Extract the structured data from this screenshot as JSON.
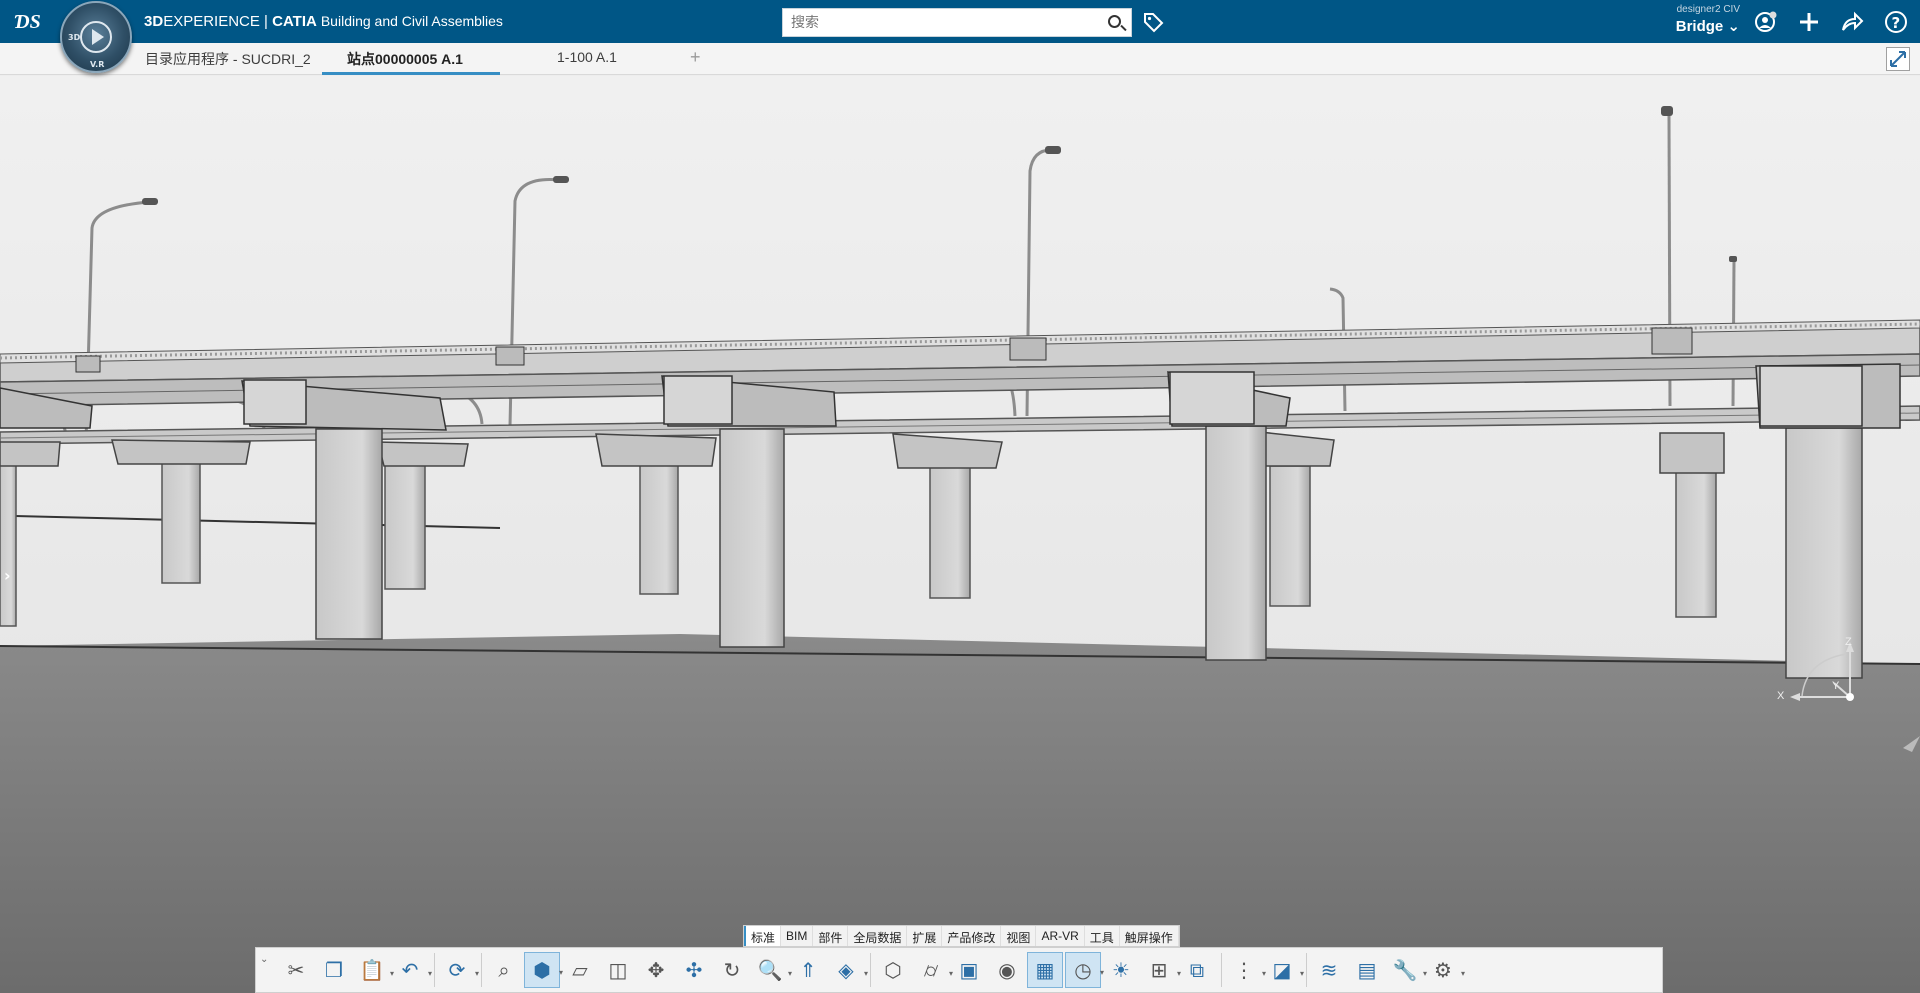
{
  "header": {
    "brand_bold": "3D",
    "brand_rest": "EXPERIENCE | ",
    "product": "CATIA",
    "app_name": "Building and Civil Assemblies",
    "search_placeholder": "搜索",
    "user_name": "designer2 CIV",
    "workspace": "Bridge",
    "compass_label_3d": "3D",
    "compass_label_vr": "V.R"
  },
  "tabs": [
    {
      "label": "目录应用程序 - SUCDRI_2",
      "active": false
    },
    {
      "label": "站点00000005 A.1",
      "active": true
    },
    {
      "label": "1-100 A.1",
      "active": false
    }
  ],
  "tab_add": "+",
  "compass_axes": {
    "x": "X",
    "y": "Y",
    "z": "Z"
  },
  "command_tabs": [
    "标准",
    "BIM",
    "部件",
    "全局数据",
    "扩展",
    "产品修改",
    "视图",
    "AR-VR",
    "工具",
    "触屏操作"
  ],
  "toolbar_icons": [
    "cut-icon",
    "copy-icon",
    "paste-icon",
    "undo-icon",
    "update-icon",
    "fit-all-icon",
    "view-cube-icon",
    "section-icon",
    "cut-plane-icon",
    "compress-icon",
    "pan-icon",
    "rotate-icon",
    "zoom-icon",
    "fly-icon",
    "render-icon",
    "shape-icon",
    "cylinder-icon",
    "hide-show-icon",
    "swap-icon",
    "select-icon",
    "clock-icon",
    "lighting-icon",
    "layout-icon",
    "explode-icon",
    "tree-icon",
    "box-select-icon",
    "layers-icon",
    "widgets-icon",
    "measure-icon",
    "tools-icon"
  ],
  "colors": {
    "topbar": "#005686",
    "accent": "#368ec4",
    "ground": "#6a6a6a",
    "sky": "#ededed"
  }
}
